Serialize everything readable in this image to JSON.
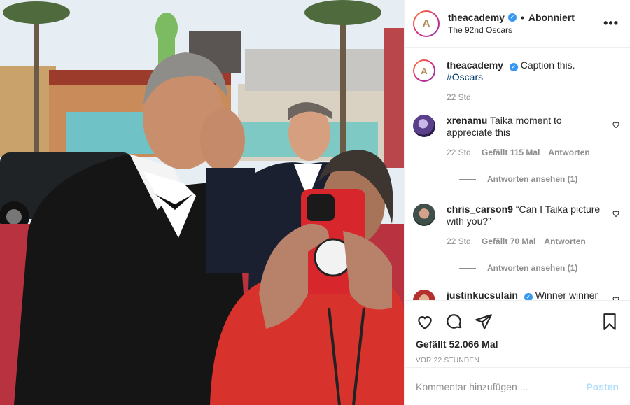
{
  "post": {
    "image_alt": "Red carpet selfie",
    "account": "theacademy",
    "verified_icon": "verified-badge-icon",
    "separator": "•",
    "follow_state": "Abonniert",
    "location": "The 92nd Oscars",
    "avatar_letter": "A",
    "more_icon": "more-options-icon"
  },
  "caption": {
    "user": "theacademy",
    "text": "Caption this.",
    "hashtag": "#Oscars",
    "time": "22 Std."
  },
  "comments": [
    {
      "user": "xrenamu",
      "text": "Taika moment to appreciate this",
      "time": "22 Std.",
      "likes": "Gefällt 115 Mal",
      "reply": "Antworten",
      "view_replies": "Antworten ansehen (1)"
    },
    {
      "user": "chris_carson9",
      "text": "“Can I Taika picture with you?”",
      "time": "22 Std.",
      "likes": "Gefällt 70 Mal",
      "reply": "Antworten",
      "view_replies": "Antworten ansehen (1)"
    },
    {
      "user": "justinkucsulain",
      "text": "Winner winner",
      "verified": true
    }
  ],
  "actions": {
    "like_icon": "heart-icon",
    "comment_icon": "comment-icon",
    "share_icon": "share-icon",
    "save_icon": "bookmark-icon",
    "likes_count": "Gefällt 52.066 Mal",
    "posted_ago": "VOR 22 STUNDEN"
  },
  "composer": {
    "placeholder": "Kommentar hinzufügen ...",
    "post_label": "Posten"
  },
  "colors": {
    "accent_blue": "#3897f0",
    "post_disabled": "#b2dffc",
    "hashtag": "#00376b",
    "muted": "#8e8e8e"
  }
}
